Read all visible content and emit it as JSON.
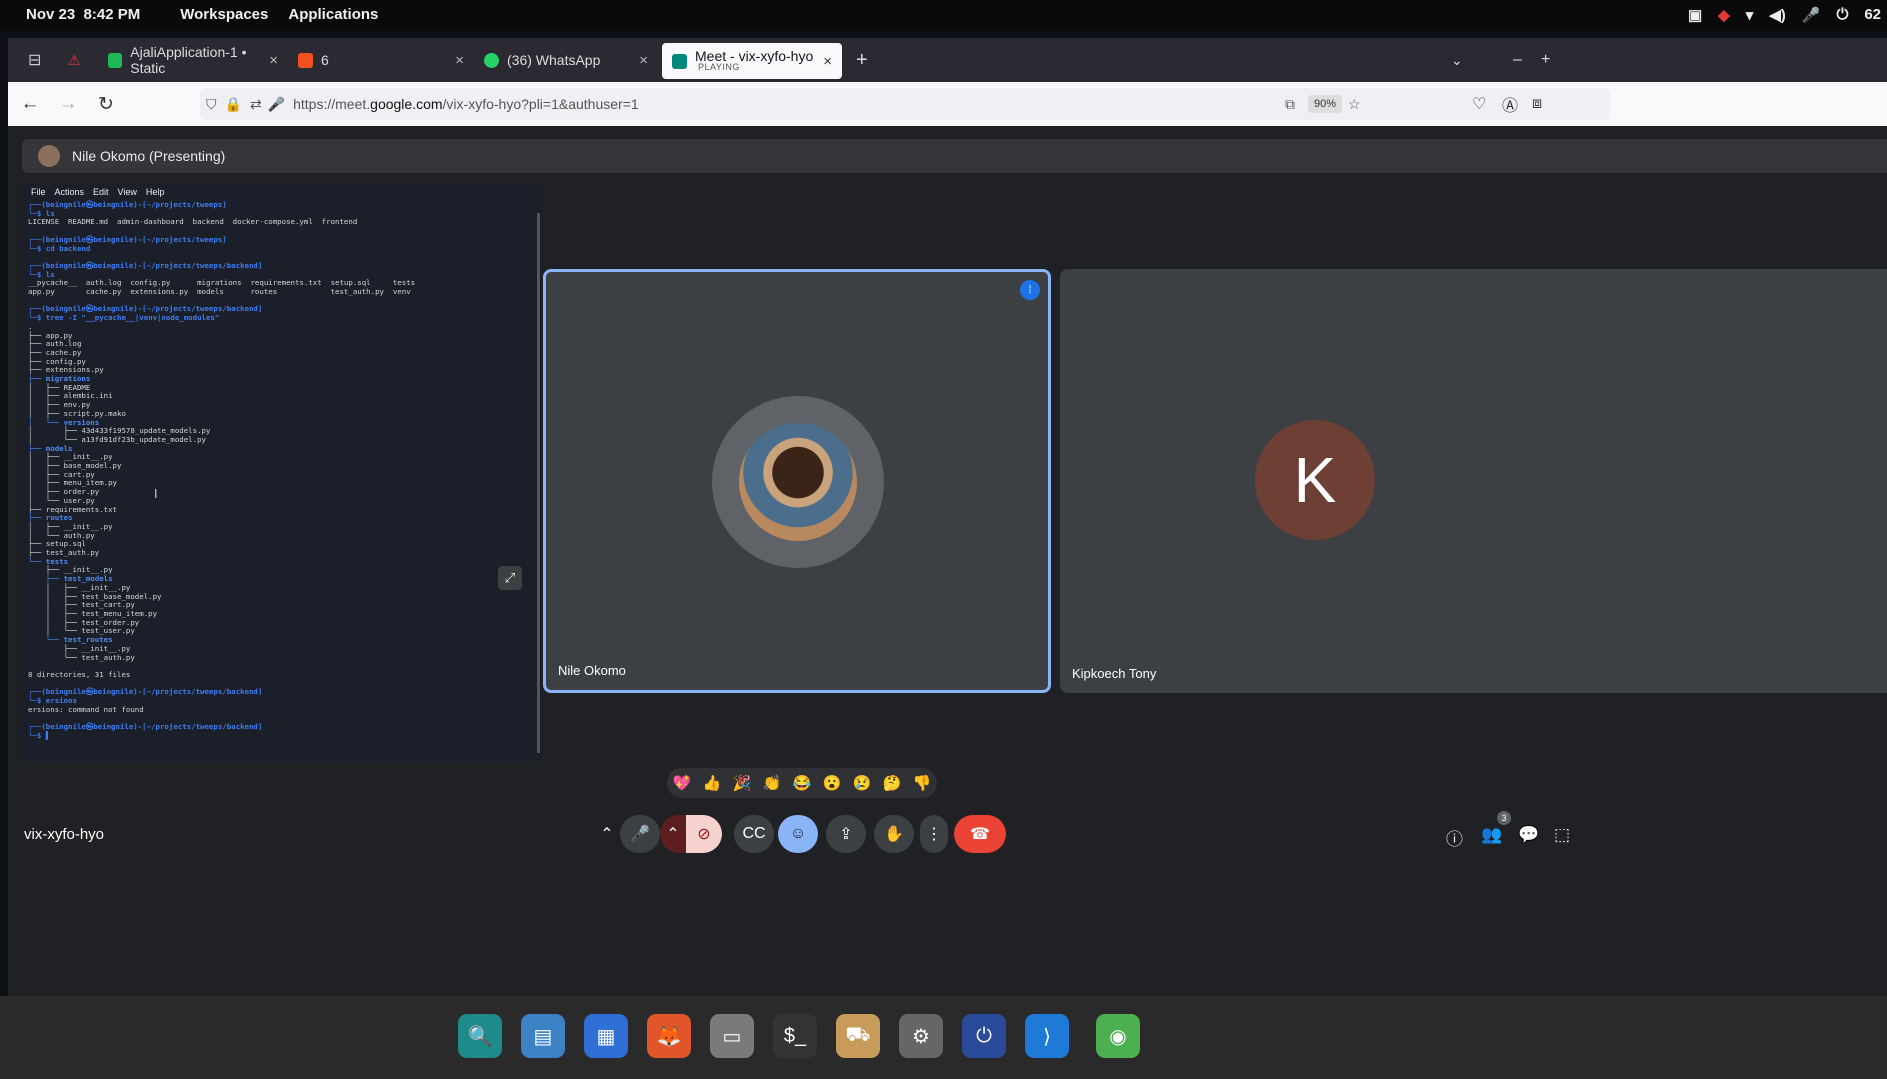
{
  "system": {
    "date": "Nov 23",
    "time": "8:42 PM",
    "menu_workspaces": "Workspaces",
    "menu_applications": "Applications",
    "battery": "62"
  },
  "tabs": [
    {
      "label": "AjaliApplication-1 • Static",
      "icon": "github-icon",
      "color": "#1db954"
    },
    {
      "label": "6",
      "icon": "blogger-icon",
      "color": "#f4511e"
    },
    {
      "label": "(36) WhatsApp",
      "icon": "whatsapp-icon",
      "color": "#25d366"
    },
    {
      "label": "Meet - vix-xyfo-hyo",
      "sublabel": "PLAYING",
      "icon": "meet-icon",
      "color": "#00897b"
    }
  ],
  "browser": {
    "url_prefix": "https://meet.",
    "url_host": "google.com",
    "url_path": "/vix-xyfo-hyo?pli=1&authuser=1",
    "zoom": "90%"
  },
  "meet": {
    "presenting": "Nile Okomo (Presenting)",
    "tile1_name": "Nile Okomo",
    "tile2_name": "Kipkoech Tony",
    "tile2_initial": "K",
    "meeting_code": "vix-xyfo-hyo",
    "people_count": "3",
    "reactions": [
      "💖",
      "👍",
      "🎉",
      "👏",
      "😂",
      "😮",
      "😢",
      "🤔",
      "👎"
    ]
  },
  "terminal": {
    "menu": [
      "File",
      "Actions",
      "Edit",
      "View",
      "Help"
    ],
    "lines": [
      {
        "p": "┌──(beingnile㉿beingnile)-[~/projects/tweeps]",
        "c": "prm"
      },
      {
        "p": "└─$ ls",
        "c": "prm"
      },
      {
        "p": "LICENSE  README.md  admin-dashboard  backend  docker-compose.yml  frontend",
        "c": ""
      },
      {
        "p": "",
        "c": ""
      },
      {
        "p": "┌──(beingnile㉿beingnile)-[~/projects/tweeps]",
        "c": "prm"
      },
      {
        "p": "└─$ cd backend",
        "c": "prm"
      },
      {
        "p": "",
        "c": ""
      },
      {
        "p": "┌──(beingnile㉿beingnile)-[~/projects/tweeps/backend]",
        "c": "prm"
      },
      {
        "p": "└─$ ls",
        "c": "prm"
      },
      {
        "p": "__pycache__  auth.log  config.py      migrations  requirements.txt  setup.sql     tests",
        "c": ""
      },
      {
        "p": "app.py       cache.py  extensions.py  models      routes            test_auth.py  venv",
        "c": ""
      },
      {
        "p": "",
        "c": ""
      },
      {
        "p": "┌──(beingnile㉿beingnile)-[~/projects/tweeps/backend]",
        "c": "prm"
      },
      {
        "p": "└─$ tree -I \"__pycache__|venv|node_modules\"",
        "c": "prm"
      },
      {
        "p": ".",
        "c": ""
      },
      {
        "p": "├── app.py",
        "c": ""
      },
      {
        "p": "├── auth.log",
        "c": ""
      },
      {
        "p": "├── cache.py",
        "c": ""
      },
      {
        "p": "├── config.py",
        "c": ""
      },
      {
        "p": "├── extensions.py",
        "c": ""
      },
      {
        "p": "├── migrations",
        "c": "dir"
      },
      {
        "p": "│   ├── README",
        "c": ""
      },
      {
        "p": "│   ├── alembic.ini",
        "c": ""
      },
      {
        "p": "│   ├── env.py",
        "c": ""
      },
      {
        "p": "│   ├── script.py.mako",
        "c": ""
      },
      {
        "p": "│   └── versions",
        "c": "dir"
      },
      {
        "p": "│       ├── 43d433f19578_update_models.py",
        "c": ""
      },
      {
        "p": "│       └── a13fd91df23b_update_model.py",
        "c": ""
      },
      {
        "p": "├── models",
        "c": "dir"
      },
      {
        "p": "│   ├── __init__.py",
        "c": ""
      },
      {
        "p": "│   ├── base_model.py",
        "c": ""
      },
      {
        "p": "│   ├── cart.py",
        "c": ""
      },
      {
        "p": "│   ├── menu_item.py",
        "c": ""
      },
      {
        "p": "│   ├── order.py",
        "c": ""
      },
      {
        "p": "│   └── user.py",
        "c": ""
      },
      {
        "p": "├── requirements.txt",
        "c": ""
      },
      {
        "p": "├── routes",
        "c": "dir"
      },
      {
        "p": "│   ├── __init__.py",
        "c": ""
      },
      {
        "p": "│   └── auth.py",
        "c": ""
      },
      {
        "p": "├── setup.sql",
        "c": ""
      },
      {
        "p": "├── test_auth.py",
        "c": ""
      },
      {
        "p": "└── tests",
        "c": "dir"
      },
      {
        "p": "    ├── __init__.py",
        "c": ""
      },
      {
        "p": "    ├── test_models",
        "c": "dir"
      },
      {
        "p": "    │   ├── __init__.py",
        "c": ""
      },
      {
        "p": "    │   ├── test_base_model.py",
        "c": ""
      },
      {
        "p": "    │   ├── test_cart.py",
        "c": ""
      },
      {
        "p": "    │   ├── test_menu_item.py",
        "c": ""
      },
      {
        "p": "    │   ├── test_order.py",
        "c": ""
      },
      {
        "p": "    │   └── test_user.py",
        "c": ""
      },
      {
        "p": "    └── test_routes",
        "c": "dir"
      },
      {
        "p": "        ├── __init__.py",
        "c": ""
      },
      {
        "p": "        └── test_auth.py",
        "c": ""
      },
      {
        "p": "",
        "c": ""
      },
      {
        "p": "8 directories, 31 files",
        "c": ""
      },
      {
        "p": "",
        "c": ""
      },
      {
        "p": "┌──(beingnile㉿beingnile)-[~/projects/tweeps/backend]",
        "c": "prm"
      },
      {
        "p": "└─$ ersions",
        "c": "prm"
      },
      {
        "p": "ersions: command not found",
        "c": ""
      },
      {
        "p": "",
        "c": ""
      },
      {
        "p": "┌──(beingnile㉿beingnile)-[~/projects/tweeps/backend]",
        "c": "prm"
      },
      {
        "p": "└─$ ▌",
        "c": "prm"
      }
    ]
  },
  "dock": [
    {
      "name": "search-app-icon",
      "glyph": "🔍",
      "color": "#1f8a8a"
    },
    {
      "name": "files-manager-icon",
      "glyph": "▤",
      "color": "#3b82c4"
    },
    {
      "name": "app-grid-icon",
      "glyph": "▦",
      "color": "#2f6fd6"
    },
    {
      "name": "firefox-icon",
      "glyph": "🦊",
      "color": "#e0562a"
    },
    {
      "name": "folder-icon",
      "glyph": "▭",
      "color": "#7a7a7a"
    },
    {
      "name": "terminal-icon",
      "glyph": "$_",
      "color": "#333"
    },
    {
      "name": "archive-icon",
      "glyph": "⛟",
      "color": "#c89b5a"
    },
    {
      "name": "settings-icon",
      "glyph": "⚙",
      "color": "#666"
    },
    {
      "name": "power-app-icon",
      "glyph": "⏻",
      "color": "#2a4a9a"
    },
    {
      "name": "vscode-icon",
      "glyph": "⟩",
      "color": "#1e7ad6"
    },
    {
      "name": "chrome-icon",
      "glyph": "◉",
      "color": "#4caf50"
    }
  ]
}
